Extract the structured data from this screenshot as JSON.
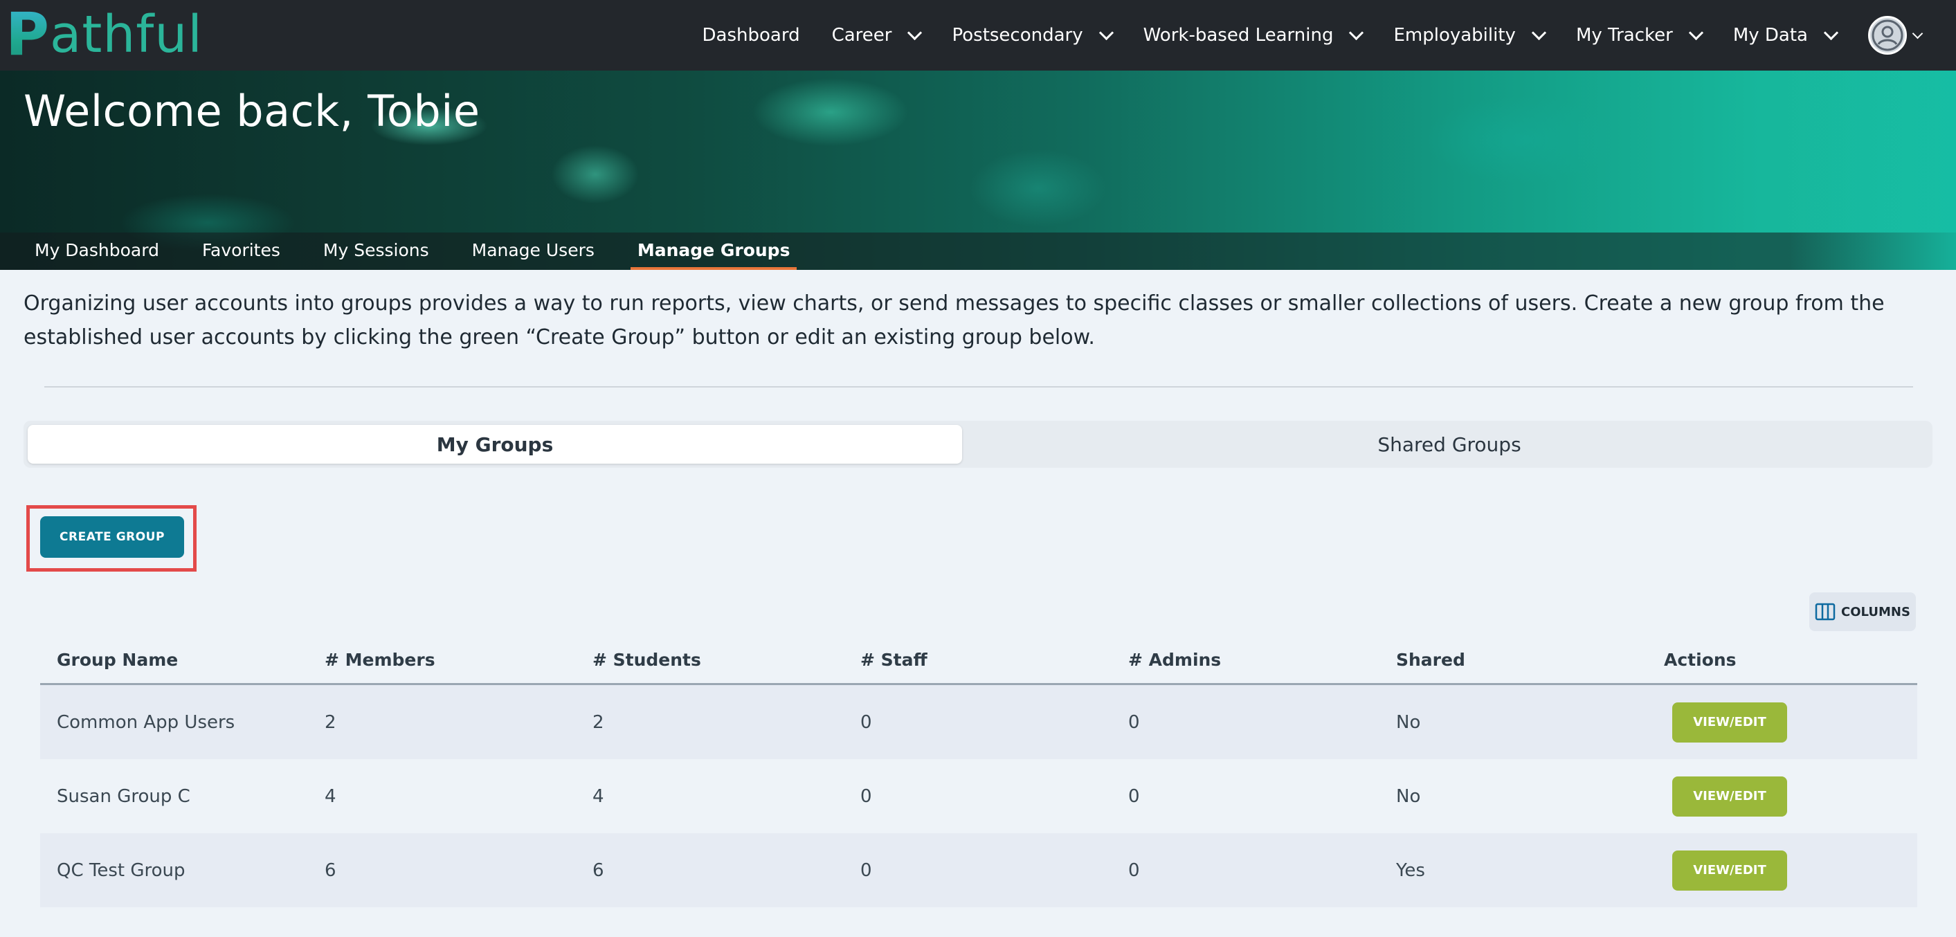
{
  "brand": {
    "logo_text": "Pathful",
    "logo_initial": "P",
    "logo_rest": "athful"
  },
  "topnav": {
    "items": [
      {
        "label": "Dashboard",
        "has_dropdown": false
      },
      {
        "label": "Career",
        "has_dropdown": true
      },
      {
        "label": "Postsecondary",
        "has_dropdown": true
      },
      {
        "label": "Work-based Learning",
        "has_dropdown": true
      },
      {
        "label": "Employability",
        "has_dropdown": true
      },
      {
        "label": "My Tracker",
        "has_dropdown": true
      },
      {
        "label": "My Data",
        "has_dropdown": true
      }
    ],
    "avatar_icon": "user-circle-icon"
  },
  "banner": {
    "welcome": "Welcome back, Tobie"
  },
  "subnav": {
    "items": [
      "My Dashboard",
      "Favorites",
      "My Sessions",
      "Manage Users",
      "Manage Groups"
    ],
    "active_index": 4
  },
  "description": "Organizing user accounts into groups provides a way to run reports, view charts, or send messages to specific classes or smaller collections of users. Create a new group from the established user accounts by clicking the green “Create Group” button or edit an existing group below.",
  "tabs": {
    "my_groups": "My Groups",
    "shared_groups": "Shared Groups",
    "active": "My Groups"
  },
  "actions": {
    "create_group": "CREATE GROUP",
    "columns": "COLUMNS"
  },
  "table": {
    "headers": [
      "Group Name",
      "# Members",
      "# Students",
      "# Staff",
      "# Admins",
      "Shared",
      "Actions"
    ],
    "rows": [
      {
        "name": "Common App Users",
        "members": "2",
        "students": "2",
        "staff": "0",
        "admins": "0",
        "shared": "No",
        "action": "VIEW/EDIT"
      },
      {
        "name": "Susan Group C",
        "members": "4",
        "students": "4",
        "staff": "0",
        "admins": "0",
        "shared": "No",
        "action": "VIEW/EDIT"
      },
      {
        "name": "QC Test Group",
        "members": "6",
        "students": "6",
        "staff": "0",
        "admins": "0",
        "shared": "Yes",
        "action": "VIEW/EDIT"
      }
    ]
  },
  "colors": {
    "nav_bg": "#23272c",
    "brand_teal": "#2bb59a",
    "create_button": "#0e7a93",
    "view_edit_button": "#9ab83a",
    "active_underline": "#e8763a",
    "highlight_box": "#e34a4a"
  }
}
